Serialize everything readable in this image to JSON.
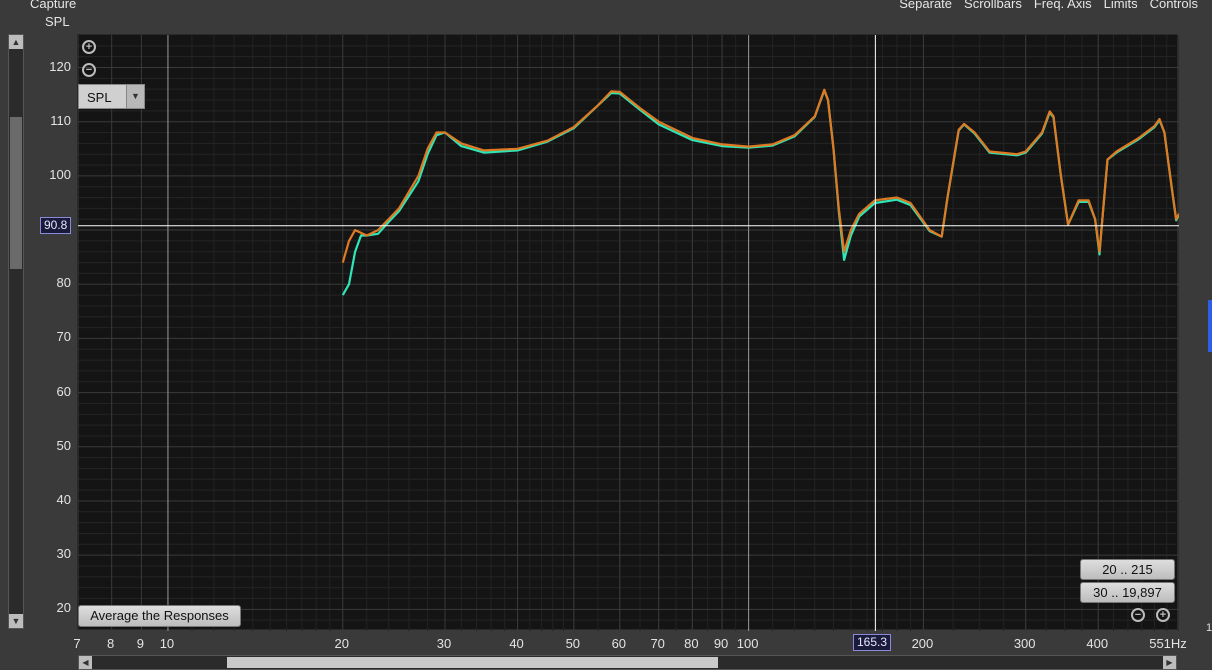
{
  "header": {
    "title": "Capture",
    "menu": [
      "Separate",
      "Scrollbars",
      "Freq. Axis",
      "Limits",
      "Controls"
    ]
  },
  "y_axis": {
    "title": "SPL",
    "ticks": [
      "120",
      "110",
      "100",
      "90",
      "80",
      "70",
      "60",
      "50",
      "40",
      "30",
      "20"
    ]
  },
  "x_axis": {
    "ticks": [
      "7",
      "8",
      "9",
      "10",
      "20",
      "30",
      "40",
      "50",
      "60",
      "70",
      "80",
      "90",
      "100",
      "200",
      "300",
      "400",
      "551Hz"
    ]
  },
  "cursor": {
    "x_readout": "165.3",
    "y_readout": "90.8",
    "freq": 165.3,
    "spl": 90.8
  },
  "controls": {
    "measurement_select": "SPL",
    "average_button": "Average the Responses",
    "range_button_1": "20 .. 215",
    "range_button_2": "30 .. 19,897"
  },
  "colors": {
    "background": "#141414",
    "series_teal": "#2ee6b8",
    "series_orange": "#e07a22",
    "cursor": "#ffffff",
    "accent": "#2d5fe6"
  },
  "right_edge_label": "1",
  "chart_data": {
    "type": "line",
    "title": "",
    "xlabel": "",
    "ylabel": "SPL",
    "xscale": "log",
    "xlim": [
      7,
      551
    ],
    "ylim": [
      16,
      126
    ],
    "grid": true,
    "series": [
      {
        "color": "#e07a22",
        "points": [
          [
            20,
            84
          ],
          [
            20.5,
            88
          ],
          [
            21,
            90
          ],
          [
            22,
            89
          ],
          [
            23,
            90
          ],
          [
            24,
            92
          ],
          [
            25,
            94
          ],
          [
            27,
            100
          ],
          [
            28,
            105
          ],
          [
            29,
            108
          ],
          [
            30,
            108
          ],
          [
            32,
            106
          ],
          [
            35,
            104.7
          ],
          [
            40,
            105
          ],
          [
            45,
            106.5
          ],
          [
            50,
            109
          ],
          [
            55,
            113
          ],
          [
            58,
            115.6
          ],
          [
            60,
            115.5
          ],
          [
            65,
            112.5
          ],
          [
            70,
            110
          ],
          [
            80,
            107
          ],
          [
            90,
            105.8
          ],
          [
            100,
            105.4
          ],
          [
            110,
            105.8
          ],
          [
            120,
            107.5
          ],
          [
            130,
            111
          ],
          [
            135,
            115.9
          ],
          [
            137,
            114
          ],
          [
            140,
            105
          ],
          [
            143,
            94
          ],
          [
            146,
            86
          ],
          [
            150,
            90
          ],
          [
            155,
            93
          ],
          [
            165,
            95.5
          ],
          [
            180,
            96
          ],
          [
            190,
            95
          ],
          [
            205,
            90
          ],
          [
            215,
            88.8
          ],
          [
            220,
            96
          ],
          [
            230,
            108.5
          ],
          [
            235,
            109.6
          ],
          [
            245,
            108
          ],
          [
            260,
            104.5
          ],
          [
            290,
            104
          ],
          [
            300,
            104.5
          ],
          [
            320,
            108
          ],
          [
            330,
            111.9
          ],
          [
            335,
            111
          ],
          [
            345,
            100
          ],
          [
            355,
            91
          ],
          [
            370,
            95.5
          ],
          [
            385,
            95.5
          ],
          [
            395,
            92
          ],
          [
            402,
            86
          ],
          [
            405,
            90
          ],
          [
            415,
            103
          ],
          [
            430,
            104.5
          ],
          [
            470,
            107
          ],
          [
            500,
            109.2
          ],
          [
            510,
            110.5
          ],
          [
            520,
            108
          ],
          [
            535,
            98
          ],
          [
            545,
            92
          ],
          [
            551,
            93
          ]
        ]
      },
      {
        "color": "#2ee6b8",
        "points": [
          [
            20,
            78
          ],
          [
            20.5,
            80
          ],
          [
            21,
            86
          ],
          [
            21.5,
            89
          ],
          [
            22,
            89
          ],
          [
            23,
            89.3
          ],
          [
            24,
            91.5
          ],
          [
            25,
            93.5
          ],
          [
            27,
            99
          ],
          [
            28,
            104
          ],
          [
            29,
            107.5
          ],
          [
            30,
            108
          ],
          [
            32,
            105.5
          ],
          [
            35,
            104.3
          ],
          [
            40,
            104.7
          ],
          [
            45,
            106.3
          ],
          [
            50,
            108.8
          ],
          [
            55,
            113
          ],
          [
            58,
            115.3
          ],
          [
            60,
            115.2
          ],
          [
            65,
            112.2
          ],
          [
            70,
            109.5
          ],
          [
            80,
            106.6
          ],
          [
            90,
            105.5
          ],
          [
            100,
            105.2
          ],
          [
            110,
            105.6
          ],
          [
            120,
            107.3
          ],
          [
            130,
            110.9
          ],
          [
            135,
            115.8
          ],
          [
            137,
            114
          ],
          [
            140,
            105
          ],
          [
            143,
            93.5
          ],
          [
            146,
            84.5
          ],
          [
            150,
            89
          ],
          [
            155,
            92.5
          ],
          [
            165,
            95
          ],
          [
            180,
            95.6
          ],
          [
            190,
            94.6
          ],
          [
            205,
            89.8
          ],
          [
            215,
            88.8
          ],
          [
            220,
            96
          ],
          [
            230,
            108.4
          ],
          [
            235,
            109.5
          ],
          [
            245,
            107.8
          ],
          [
            260,
            104.3
          ],
          [
            290,
            103.8
          ],
          [
            300,
            104.3
          ],
          [
            320,
            107.8
          ],
          [
            330,
            111.7
          ],
          [
            335,
            110.8
          ],
          [
            345,
            100
          ],
          [
            355,
            91
          ],
          [
            370,
            95.2
          ],
          [
            385,
            95.2
          ],
          [
            395,
            92
          ],
          [
            402,
            85.5
          ],
          [
            405,
            90
          ],
          [
            415,
            103
          ],
          [
            430,
            104.3
          ],
          [
            470,
            106.8
          ],
          [
            500,
            109
          ],
          [
            510,
            110.3
          ],
          [
            520,
            108
          ],
          [
            535,
            98
          ],
          [
            545,
            91.8
          ],
          [
            551,
            92.8
          ]
        ]
      }
    ]
  }
}
